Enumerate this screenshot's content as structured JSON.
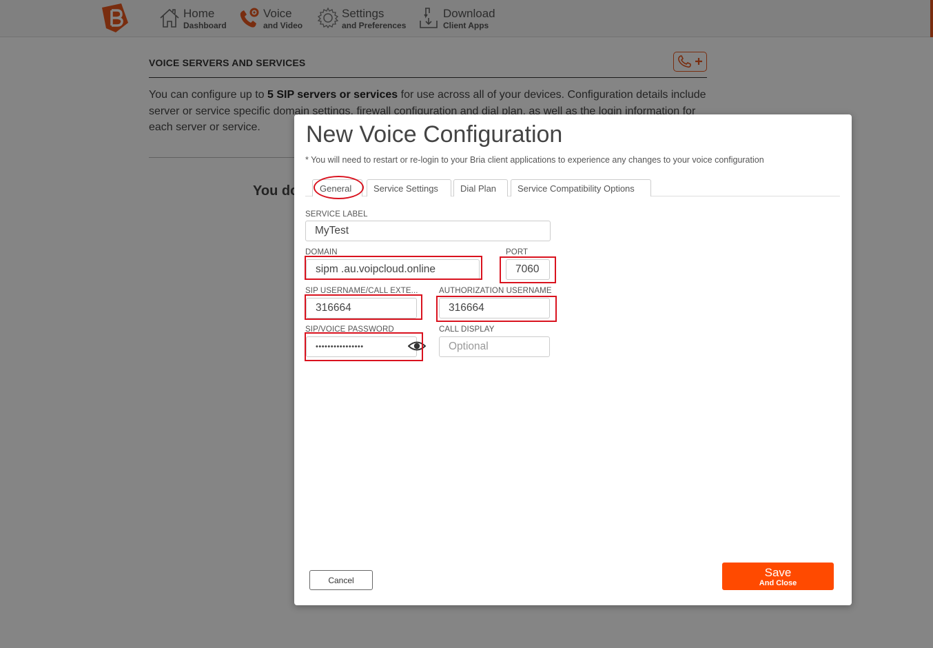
{
  "nav": {
    "items": [
      {
        "title": "Home",
        "subtitle": "Dashboard",
        "icon": "home-icon"
      },
      {
        "title": "Voice",
        "subtitle": "and Video",
        "icon": "phone-gear-icon"
      },
      {
        "title": "Settings",
        "subtitle": "and Preferences",
        "icon": "gear-icon"
      },
      {
        "title": "Download",
        "subtitle": "Client Apps",
        "icon": "download-icon"
      }
    ]
  },
  "page": {
    "section_title": "VOICE SERVERS AND SERVICES",
    "intro_before": "You can configure up to ",
    "intro_bold": "5 SIP servers or services",
    "intro_after": " for use across all of your devices. Configuration details include server or service specific domain settings, firewall configuration and dial plan, as well as the login information for each server or service.",
    "partial_heading": "You do"
  },
  "modal": {
    "title": "New Voice Configuration",
    "note": "* You will need to restart or re-login to your Bria client applications to experience any changes to your voice configuration",
    "tabs": [
      "General",
      "Service Settings",
      "Dial Plan",
      "Service Compatibility Options"
    ],
    "fields": {
      "service_label": {
        "label": "SERVICE LABEL",
        "value": "MyTest"
      },
      "domain": {
        "label": "DOMAIN",
        "value": "sipm .au.voipcloud.online"
      },
      "port": {
        "label": "PORT",
        "value": "7060"
      },
      "sip_username": {
        "label": "SIP USERNAME/CALL EXTE...",
        "value": "316664"
      },
      "auth_username": {
        "label": "AUTHORIZATION USERNAME",
        "value": "316664"
      },
      "password": {
        "label": "SIP/VOICE PASSWORD",
        "value": "••••••••••••••••"
      },
      "call_display": {
        "label": "CALL DISPLAY",
        "placeholder": "Optional"
      }
    },
    "cancel_label": "Cancel",
    "save_label": "Save",
    "save_sub_label": "And Close"
  },
  "colors": {
    "accent": "#ff4a00",
    "brand": "#e8571e",
    "highlight": "#d9121e"
  }
}
